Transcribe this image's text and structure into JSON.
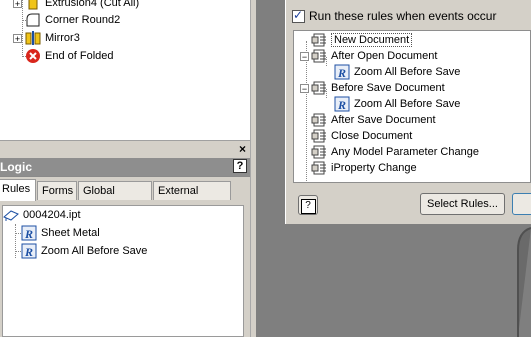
{
  "browser_tree": {
    "items": [
      {
        "label": "Extrusion4 (Cut All)",
        "icon": "extrusion-icon",
        "expandable": true
      },
      {
        "label": "Corner Round2",
        "icon": "corner-round-icon",
        "expandable": false
      },
      {
        "label": "Mirror3",
        "icon": "mirror-icon",
        "expandable": true
      },
      {
        "label": "End of Folded",
        "icon": "end-of-folded-icon",
        "expandable": false
      }
    ]
  },
  "splitter": {
    "close_symbol": "×"
  },
  "logic": {
    "title": "Logic",
    "help_symbol": "?",
    "tabs": [
      {
        "label": "Rules",
        "active": true
      },
      {
        "label": "Forms",
        "active": false
      },
      {
        "label": "Global Forms",
        "active": false
      },
      {
        "label": "External Rules",
        "active": false
      }
    ],
    "tree": {
      "root": "0004204.ipt",
      "rules": [
        "Sheet Metal",
        "Zoom All Before Save"
      ]
    }
  },
  "dialog": {
    "checkbox_label": "Run these rules when events occur",
    "checkbox_checked": true,
    "events": [
      {
        "label": "New Document",
        "level": 0,
        "expander": "",
        "highlight": true
      },
      {
        "label": "After Open Document",
        "level": 0,
        "expander": "−"
      },
      {
        "label": "Zoom All Before Save",
        "level": 1,
        "rule": true
      },
      {
        "label": "Before Save Document",
        "level": 0,
        "expander": "−"
      },
      {
        "label": "Zoom All Before Save",
        "level": 1,
        "rule": true
      },
      {
        "label": "After Save Document",
        "level": 0,
        "expander": ""
      },
      {
        "label": "Close Document",
        "level": 0,
        "expander": ""
      },
      {
        "label": "Any Model Parameter Change",
        "level": 0,
        "expander": ""
      },
      {
        "label": "iProperty Change",
        "level": 0,
        "expander": ""
      }
    ],
    "help_symbol": "?",
    "select_rules_label": "Select Rules..."
  },
  "colors": {
    "accent_blue": "#1c4fa3",
    "error_red": "#d9261c",
    "folder_yellow": "#f0c419"
  }
}
